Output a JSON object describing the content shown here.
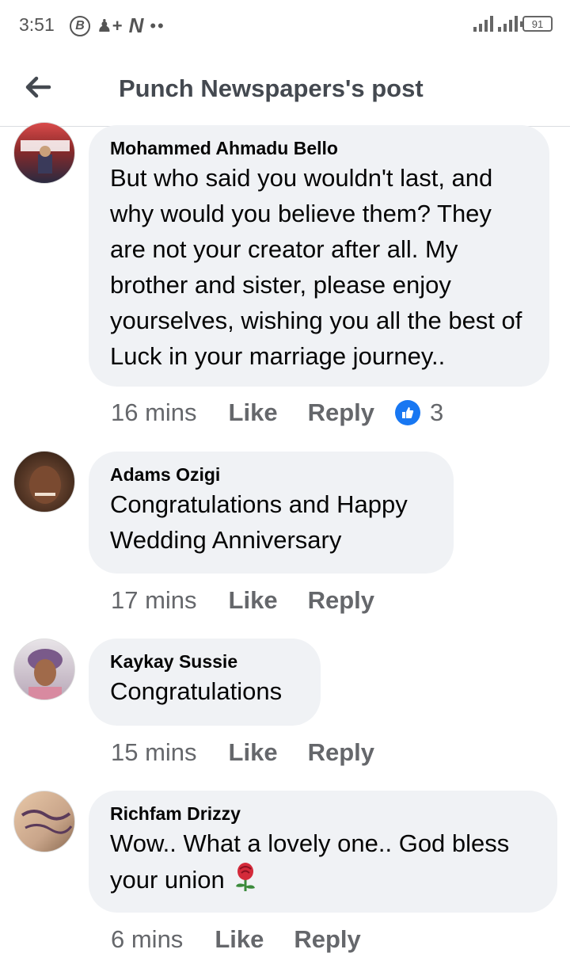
{
  "status_bar": {
    "time": "3:51",
    "left_icons": [
      "b-circle-icon",
      "person-plus-icon",
      "n-logo-icon",
      "more-dots-icon"
    ],
    "battery": "91"
  },
  "header": {
    "back_icon": "arrow-left-icon",
    "title": "Punch Newspapers's post"
  },
  "comments": [
    {
      "author": "Mohammed Ahmadu Bello",
      "text": "But who said you wouldn't last, and why would you believe them? They are not your creator after all. My brother and sister, please enjoy yourselves, wishing you all the best of Luck in your marriage journey..",
      "time": "16 mins",
      "like_label": "Like",
      "reply_label": "Reply",
      "reaction_count": "3",
      "avatar_color": "#8a2a2a"
    },
    {
      "author": "Adams Ozigi",
      "text": "Congratulations and Happy Wedding Anniversary",
      "time": "17 mins",
      "like_label": "Like",
      "reply_label": "Reply",
      "avatar_color": "#5a3a28"
    },
    {
      "author": "Kaykay Sussie",
      "text": "Congratulations",
      "time": "15 mins",
      "like_label": "Like",
      "reply_label": "Reply",
      "avatar_color": "#6b4a5a"
    },
    {
      "author": "Richfam Drizzy",
      "text": "Wow.. What a lovely one.. God bless your union",
      "emoji": "rose-icon",
      "time": "6 mins",
      "like_label": "Like",
      "reply_label": "Reply",
      "avatar_color": "#c9a58a"
    }
  ],
  "colors": {
    "bubble": "#f0f2f5",
    "meta_text": "#65676b",
    "like_blue": "#1877f2"
  }
}
